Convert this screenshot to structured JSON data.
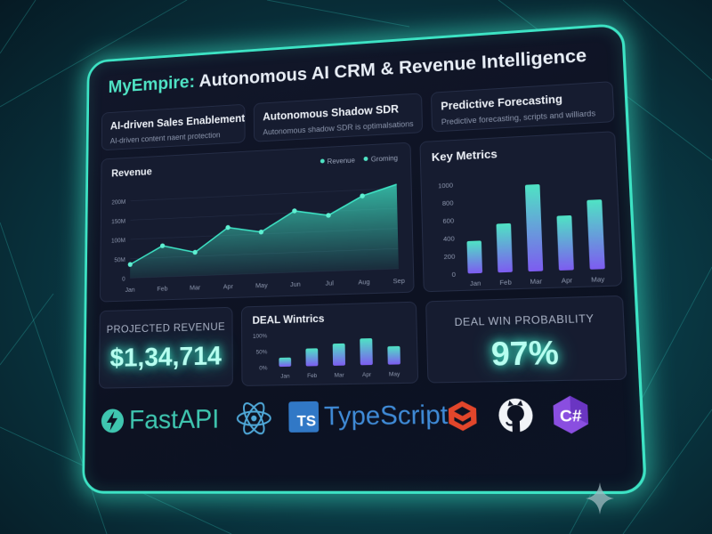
{
  "header": {
    "brand": "MyEmpire:",
    "title": "Autonomous AI CRM & Revenue Intelligence"
  },
  "features": [
    {
      "title": "AI-driven Sales Enablement",
      "subtitle": "AI-driven content naent protection"
    },
    {
      "title": "Autonomous Shadow SDR",
      "subtitle": "Autonomous shadow SDR is optimalsations"
    },
    {
      "title": "Predictive Forecasting",
      "subtitle": "Predictive forecasting, scripts and williards"
    }
  ],
  "revenue_card": {
    "title": "Revenue",
    "legend": [
      "Revenue",
      "Groming"
    ]
  },
  "metrics_card": {
    "title": "Key Metrics"
  },
  "projected": {
    "label": "PROJECTED REVENUE",
    "value": "$1,34,714"
  },
  "deal_metrics": {
    "title": "DEAL Wintrics"
  },
  "win_probability": {
    "label": "DEAL WIN PROBABILITY",
    "value": "97%"
  },
  "logos": {
    "fastapi": "FastAPI",
    "typescript_badge": "TS",
    "typescript": "TypeScript",
    "csharp": "C#"
  },
  "icons": {
    "fastapi": "bolt-icon",
    "react": "react-atom-icon",
    "swift": "swift-stack-icon",
    "github": "github-octocat-icon",
    "csharp": "csharp-hexagon-icon"
  },
  "colors": {
    "accent": "#3de3c4",
    "bar_top": "#4fe3c4",
    "bar_bottom": "#7d5cf0",
    "typescript": "#3178c6"
  },
  "chart_data": [
    {
      "type": "area",
      "title": "Revenue",
      "categories": [
        "Jan",
        "Feb",
        "Mar",
        "Apr",
        "May",
        "Jun",
        "Jul",
        "Aug",
        "Sep"
      ],
      "series": [
        {
          "name": "Revenue",
          "values": [
            35,
            80,
            60,
            120,
            105,
            155,
            140,
            185,
            210
          ]
        }
      ],
      "yticks": [
        "0",
        "50M",
        "100M",
        "150M",
        "200M"
      ],
      "ylim": [
        0,
        220
      ]
    },
    {
      "type": "bar",
      "title": "Key Metrics",
      "categories": [
        "Jan",
        "Feb",
        "Mar",
        "Apr",
        "May"
      ],
      "values": [
        360,
        540,
        960,
        600,
        760
      ],
      "yticks": [
        "0",
        "200",
        "400",
        "600",
        "800",
        "1000"
      ],
      "ylim": [
        0,
        1000
      ]
    },
    {
      "type": "bar",
      "title": "DEAL Wintrics",
      "categories": [
        "Jan",
        "Feb",
        "Mar",
        "Apr",
        "May"
      ],
      "values": [
        28,
        55,
        68,
        82,
        56
      ],
      "yticks": [
        "0%",
        "50%",
        "100%"
      ],
      "ylim": [
        0,
        100
      ]
    }
  ]
}
